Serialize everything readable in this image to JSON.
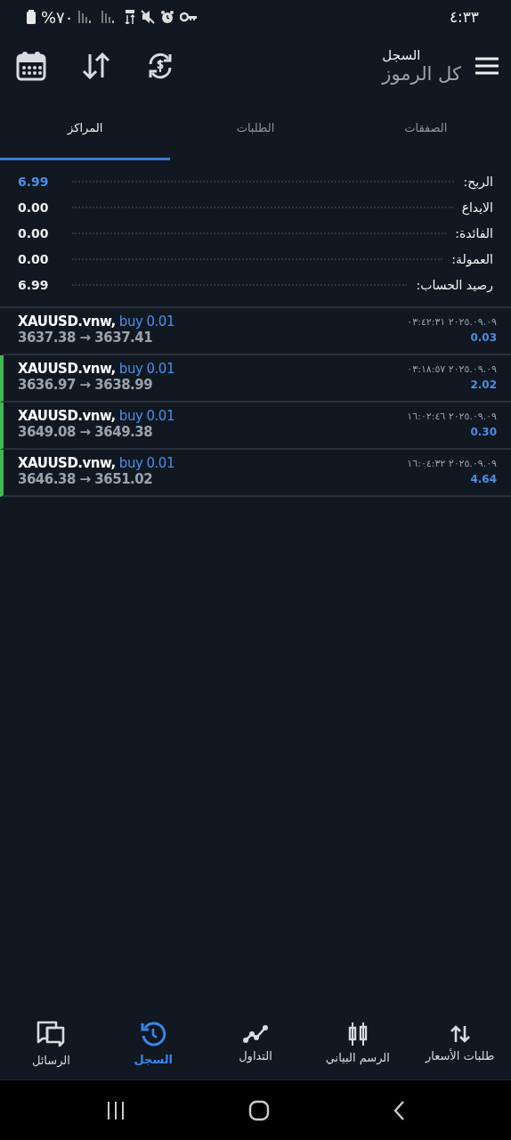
{
  "status_bar": {
    "time": "٤:٣٣",
    "battery": "%٧٠"
  },
  "header": {
    "title": "السجل",
    "subtitle": "كل الرموز"
  },
  "tabs": [
    {
      "label": "الصفقات",
      "selected": false
    },
    {
      "label": "الطلبات",
      "selected": false
    },
    {
      "label": "المراكز",
      "selected": true
    }
  ],
  "summary": [
    {
      "label": "الربح:",
      "value": "6.99",
      "highlight": true
    },
    {
      "label": "الايداع",
      "value": "0.00",
      "highlight": false
    },
    {
      "label": "الفائدة:",
      "value": "0.00",
      "highlight": false
    },
    {
      "label": "العمولة:",
      "value": "0.00",
      "highlight": false
    },
    {
      "label": "رصيد الحساب:",
      "value": "6.99",
      "highlight": false
    }
  ],
  "positions": [
    {
      "symbol": "XAUUSD.vnw,",
      "order": "buy 0.01",
      "prices": "3637.38 → 3637.41",
      "time": "٢٠٢٥.٠٩.٠٩ ٠٣:٤٢:٣١",
      "profit": "0.03",
      "marked": false
    },
    {
      "symbol": "XAUUSD.vnw,",
      "order": "buy 0.01",
      "prices": "3636.97 → 3638.99",
      "time": "٢٠٢٥.٠٩.٠٩ ٠٣:١٨:٥٧",
      "profit": "2.02",
      "marked": true
    },
    {
      "symbol": "XAUUSD.vnw,",
      "order": "buy 0.01",
      "prices": "3649.08 → 3649.38",
      "time": "٢٠٢٥.٠٩.٠٩ ١٦:٠٢:٤٦",
      "profit": "0.30",
      "marked": true
    },
    {
      "symbol": "XAUUSD.vnw,",
      "order": "buy 0.01",
      "prices": "3646.38 → 3651.02",
      "time": "٢٠٢٥.٠٩.٠٩ ١٦:٠٤:٣٢",
      "profit": "4.64",
      "marked": true
    }
  ],
  "bottom_nav": [
    {
      "label": "طلبات الأسعار",
      "kind": "quotes",
      "selected": false
    },
    {
      "label": "الرسم البياني",
      "kind": "chart",
      "selected": false
    },
    {
      "label": "التداول",
      "kind": "trade",
      "selected": false
    },
    {
      "label": "السجل",
      "kind": "history",
      "selected": true
    },
    {
      "label": "الرسائل",
      "kind": "messages",
      "selected": false
    }
  ]
}
